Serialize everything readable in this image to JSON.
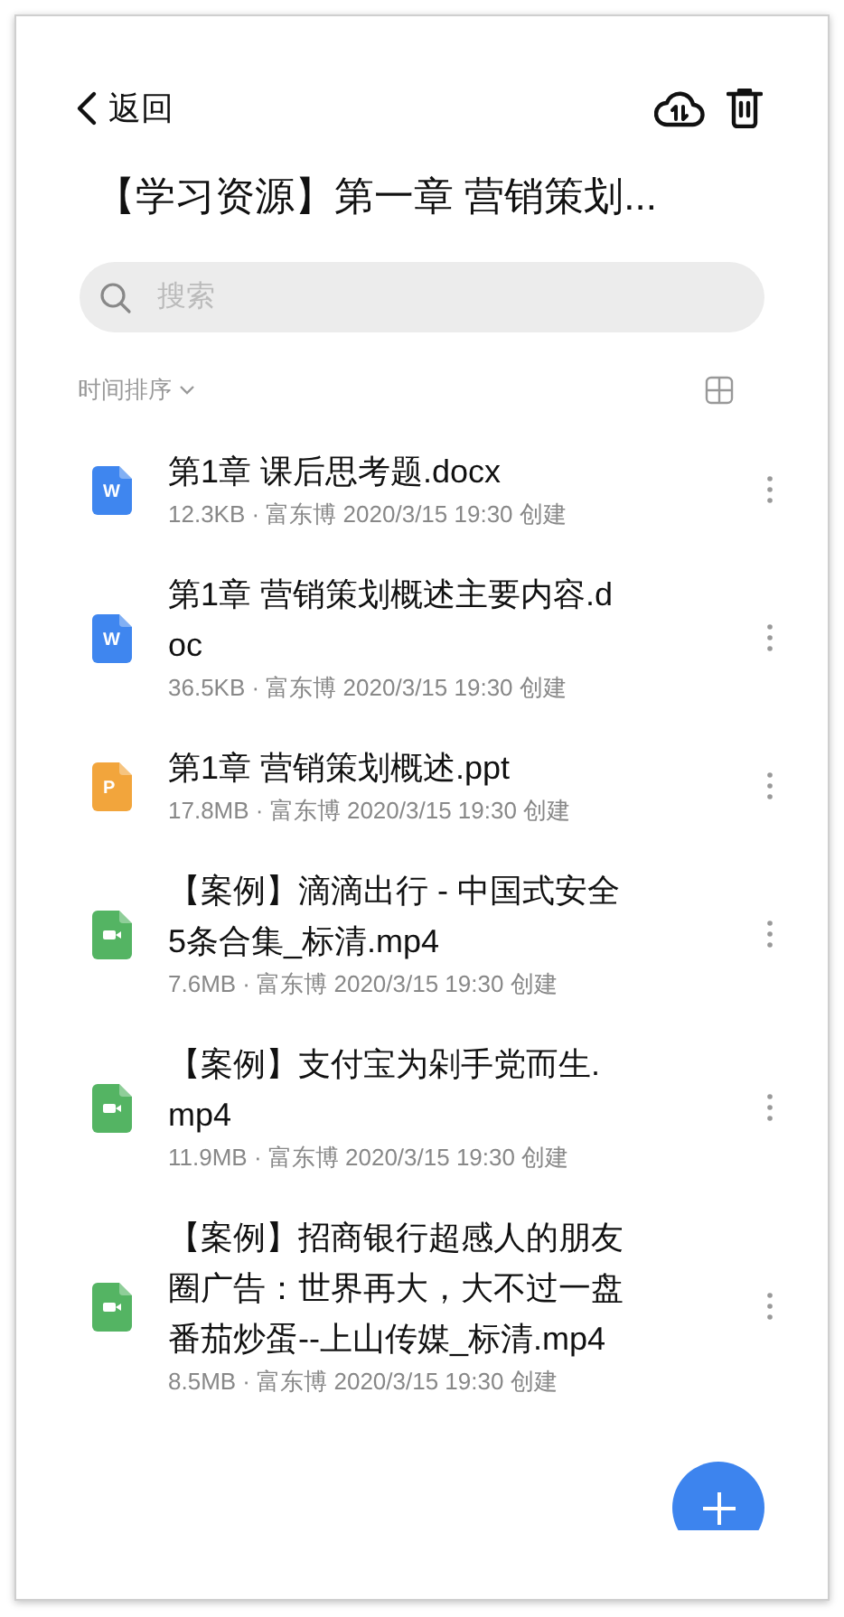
{
  "header": {
    "back_label": "返回",
    "title": "【学习资源】第一章 营销策划..."
  },
  "search": {
    "placeholder": "搜索"
  },
  "sort": {
    "label": "时间排序"
  },
  "files": [
    {
      "kind": "word",
      "badge": "W",
      "name": "第1章 课后思考题.docx",
      "meta": "12.3KB · 富东博 2020/3/15 19:30 创建"
    },
    {
      "kind": "word",
      "badge": "W",
      "name": "第1章 营销策划概述主要内容.doc",
      "meta": "36.5KB · 富东博 2020/3/15 19:30 创建"
    },
    {
      "kind": "ppt",
      "badge": "P",
      "name": "第1章 营销策划概述.ppt",
      "meta": "17.8MB · 富东博 2020/3/15 19:30 创建"
    },
    {
      "kind": "video",
      "name": "【案例】滴滴出行 - 中国式安全5条合集_标清.mp4",
      "meta": "7.6MB · 富东博 2020/3/15 19:30 创建"
    },
    {
      "kind": "video",
      "name": "【案例】支付宝为剁手党而生.mp4",
      "meta": "11.9MB · 富东博 2020/3/15 19:30 创建"
    },
    {
      "kind": "video",
      "name": "【案例】招商银行超感人的朋友圈广告：世界再大，大不过一盘番茄炒蛋--上山传媒_标清.mp4",
      "meta": "8.5MB · 富东博 2020/3/15 19:30 创建"
    }
  ]
}
